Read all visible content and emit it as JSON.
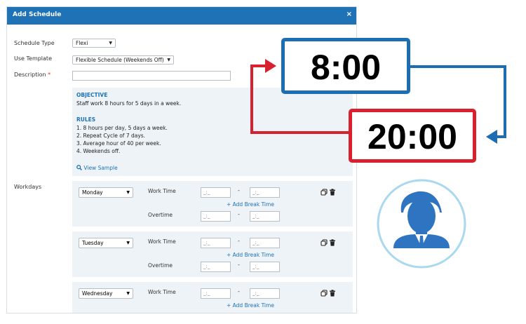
{
  "dialog": {
    "title": "Add Schedule",
    "close_icon": "×",
    "schedule_type": {
      "label": "Schedule Type",
      "value": "Flexi"
    },
    "use_template": {
      "label": "Use Template",
      "value": "Flexible Schedule (Weekends Off)"
    },
    "description": {
      "label": "Description",
      "required_mark": "*",
      "value": ""
    },
    "info": {
      "objective_heading": "OBJECTIVE",
      "objective_text": "Staff work 8 hours for 5 days in a week.",
      "rules_heading": "RULES",
      "rules": [
        "1. 8 hours per day, 5 days a week.",
        "2. Repeat Cycle of 7 days.",
        "3. Average hour of 40 per week.",
        "4. Weekends off."
      ],
      "view_sample": "View Sample"
    },
    "workdays_label": "Workdays",
    "time_placeholder": "_:_",
    "work_time_label": "Work Time",
    "overtime_label": "Overtime",
    "add_break_label": "+ Add Break Time",
    "dash": "-",
    "days": [
      "Monday",
      "Tuesday",
      "Wednesday"
    ]
  },
  "illustration": {
    "start_time": "8:00",
    "end_time": "20:00",
    "icons": [
      "clock-cycle-arrows",
      "user-avatar-icon"
    ]
  },
  "colors": {
    "header": "#1f72b6",
    "start_border": "#1d6db3",
    "end_border": "#d9202e",
    "avatar": "#2f74c0",
    "avatar_ring": "#a9d8ef"
  }
}
